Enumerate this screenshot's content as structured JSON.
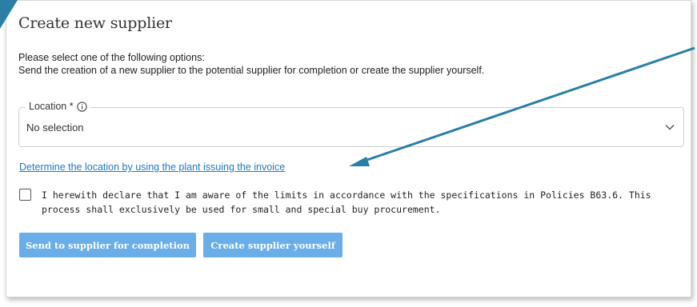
{
  "dialog": {
    "title": "Create new supplier",
    "intro_line1": "Please select one of the following options:",
    "intro_line2": "Send the creation of a new supplier to the potential supplier for completion or create the supplier yourself."
  },
  "location_field": {
    "label": "Location *",
    "value": "No selection",
    "icon": "info-icon",
    "dropdown_icon": "chevron-down-icon"
  },
  "determine_link": "Determine the location by using the plant issuing the invoice",
  "declaration": {
    "checked": false,
    "text": "I herewith declare that I am aware of the limits in accordance with the specifications in Policies B63.6. This process shall exclusively be used for small and special buy procurement."
  },
  "buttons": {
    "send": "Send to supplier for completion",
    "create": "Create supplier yourself"
  },
  "colors": {
    "link": "#1f78c6",
    "button_bg": "#69aee8",
    "annotation_arrow": "#2a7fa6"
  }
}
